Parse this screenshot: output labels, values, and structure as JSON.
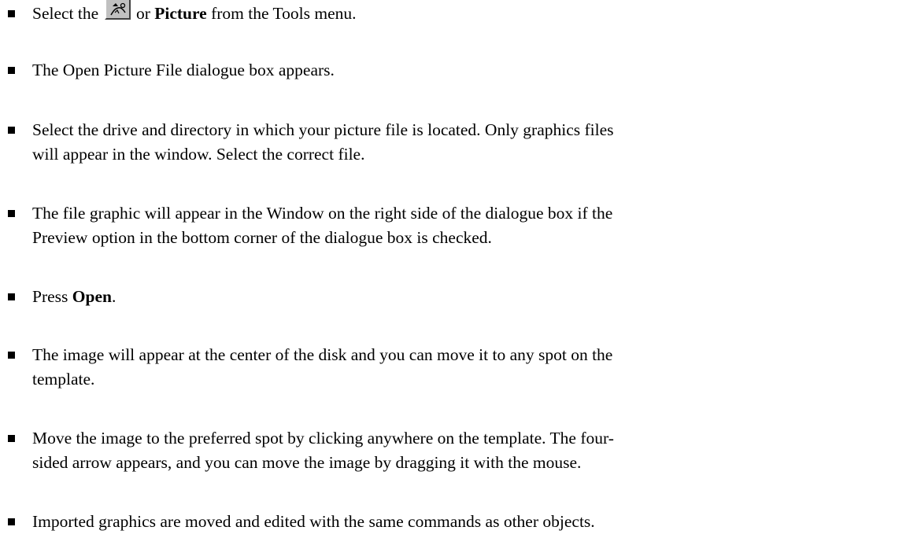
{
  "items": [
    {
      "before": "Select the ",
      "icon": "picture-tool-icon",
      "bold": "Picture",
      "after": " from the Tools menu.",
      "icon_join": " or "
    },
    {
      "line1": "The Open Picture File dialogue box appears."
    },
    {
      "line1": "Select the drive and directory in which your picture file is located.  Only graphics files",
      "line2": "will appear in the window.  Select the correct file."
    },
    {
      "line1": "The file graphic will appear in the Window on the right side of the dialogue box if the",
      "line2": "Preview option in the bottom corner of the dialogue box is checked."
    },
    {
      "before": "Press ",
      "bold": "Open",
      "after": "."
    },
    {
      "line1": "The image will appear at the center of the disk and you can move it to any spot on the",
      "line2": "template."
    },
    {
      "line1": "Move the image to the preferred spot by clicking anywhere on the template.  The four-",
      "line2": "sided arrow appears, and you can move the image by dragging it with the mouse."
    },
    {
      "line1": "Imported graphics are moved and edited with the same commands as other objects."
    }
  ]
}
